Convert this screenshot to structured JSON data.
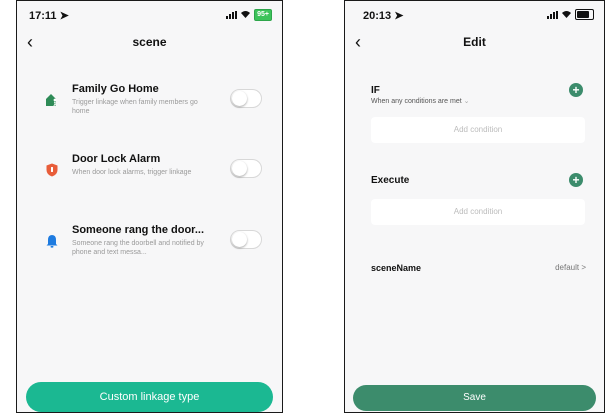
{
  "left_screen": {
    "status": {
      "time": "17:11",
      "battery": "95+"
    },
    "nav": {
      "title": "scene"
    },
    "scenes": [
      {
        "title": "Family Go Home",
        "description": "Trigger linkage when family members go home",
        "icon": "home-person-icon",
        "color": "#2e8b57",
        "enabled": false
      },
      {
        "title": "Door Lock Alarm",
        "description": "When door lock alarms, trigger linkage",
        "icon": "shield-icon",
        "color": "#e85d3a",
        "enabled": false
      },
      {
        "title": "Someone rang the door...",
        "description": "Someone rang the doorbell and notified by phone and text messa...",
        "icon": "bell-icon",
        "color": "#1e7be0",
        "enabled": false
      }
    ],
    "custom_button": "Custom linkage type"
  },
  "right_screen": {
    "status": {
      "time": "20:13"
    },
    "nav": {
      "title": "Edit"
    },
    "if_section": {
      "label": "IF",
      "sub": "When any conditions are met",
      "add_placeholder": "Add condition"
    },
    "execute_section": {
      "label": "Execute",
      "add_placeholder": "Add condition"
    },
    "scene_name": {
      "label": "sceneName",
      "value": "default >"
    },
    "save_button": "Save"
  },
  "colors": {
    "accent_green": "#1bb892",
    "save_green": "#3c8c6c"
  }
}
